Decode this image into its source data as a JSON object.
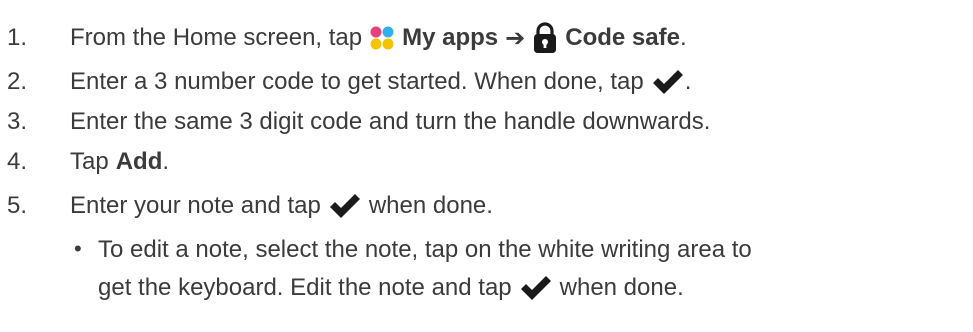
{
  "steps": [
    {
      "number": "1.",
      "text_before": "From the Home screen, tap",
      "my_apps": "My apps",
      "arrow": "➔",
      "code_safe": "Code safe",
      "end": "."
    },
    {
      "number": "2.",
      "text_before": "Enter a 3 number code to get started. When done, tap",
      "end": "."
    },
    {
      "number": "3.",
      "text": "Enter the same 3 digit code and turn the handle downwards."
    },
    {
      "number": "4.",
      "text_before": "Tap",
      "bold": "Add",
      "end": "."
    },
    {
      "number": "5.",
      "text_before": "Enter your note and tap",
      "text_after": "when done."
    }
  ],
  "sub_bullet": {
    "bullet": "•",
    "line1": "To edit a note, select the note, tap on the white writing area to",
    "line2_before": "get the keyboard. Edit the note and tap",
    "line2_after": "when done."
  },
  "colors": {
    "text": "#3b3b3b",
    "icon": "#1a1a1a",
    "apps_pink": "#e8407a",
    "apps_blue": "#2fb0e8",
    "apps_yellow": "#f5c400"
  },
  "icons": {
    "apps": "my-apps-icon",
    "lock": "padlock-icon",
    "check": "checkmark-icon"
  }
}
